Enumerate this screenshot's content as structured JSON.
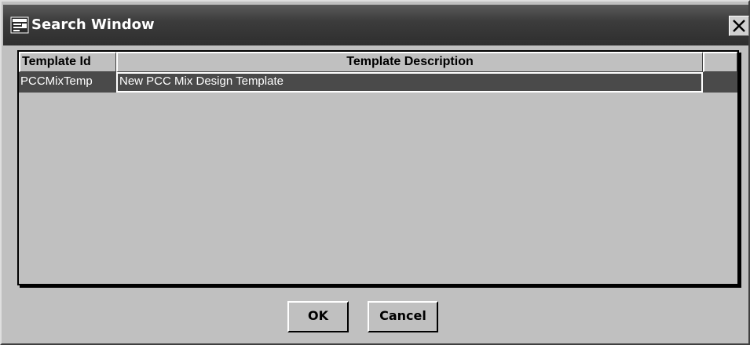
{
  "window": {
    "title": "Search Window",
    "title_icon": "app-window-icon",
    "close_icon": "close-icon"
  },
  "grid": {
    "columns": [
      "Template Id",
      "Template Description"
    ],
    "rows": [
      {
        "template_id": "PCCMixTemp",
        "template_description": "New PCC Mix Design Template",
        "selected": true
      }
    ]
  },
  "buttons": {
    "ok_label": "OK",
    "cancel_label": "Cancel"
  },
  "colors": {
    "face": "#c0c0c0",
    "titlebar": "#3c3c3c",
    "selection": "#4a4a4a"
  }
}
